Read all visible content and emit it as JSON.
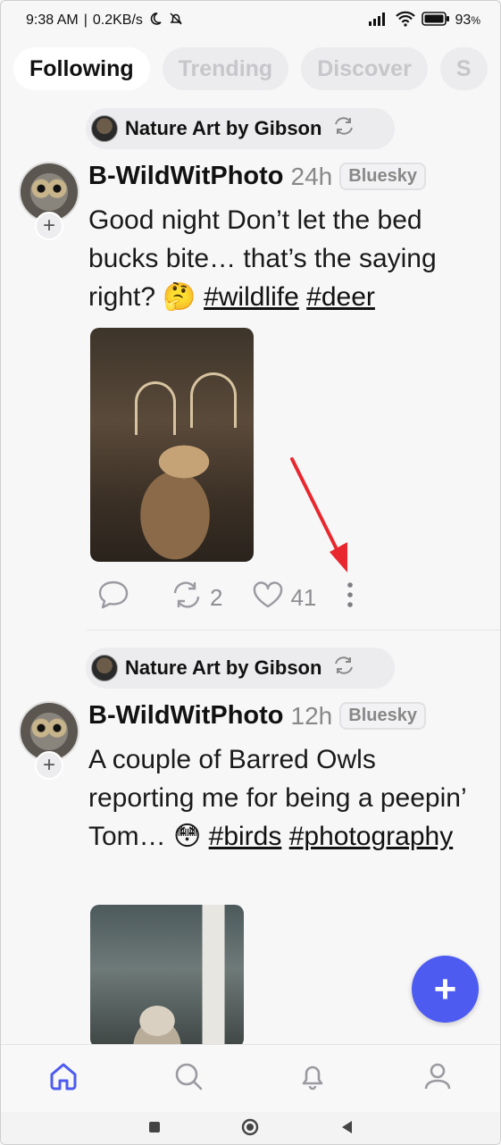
{
  "status_bar": {
    "time": "9:38 AM",
    "network_speed": "0.2KB/s",
    "battery": "93"
  },
  "tabs": [
    {
      "label": "Following",
      "active": true
    },
    {
      "label": "Trending",
      "active": false
    },
    {
      "label": "Discover",
      "active": false
    },
    {
      "label": "S",
      "active": false
    }
  ],
  "posts": [
    {
      "reposted_by": "Nature Art by Gibson",
      "author": "B-WildWitPhoto",
      "time": "24h",
      "badge": "Bluesky",
      "text": "Good night Don’t let the bed bucks bite… that’s the saying right? 🤔",
      "tags": [
        "#wildlife",
        "#deer"
      ],
      "reposts": "2",
      "likes": "41"
    },
    {
      "reposted_by": "Nature Art by Gibson",
      "author": "B-WildWitPhoto",
      "time": "12h",
      "badge": "Bluesky",
      "text": "A couple of Barred Owls reporting me for being a peepin’ Tom… 😳",
      "tags": [
        "#birds",
        "#photography"
      ]
    }
  ],
  "fab": {
    "label": "+"
  },
  "colors": {
    "accent": "#4d5bf0",
    "annotation_arrow": "#e8282e"
  },
  "icons": [
    "reply-icon",
    "repost-icon",
    "like-icon",
    "more-icon",
    "home-icon",
    "search-icon",
    "bell-icon",
    "profile-icon"
  ]
}
